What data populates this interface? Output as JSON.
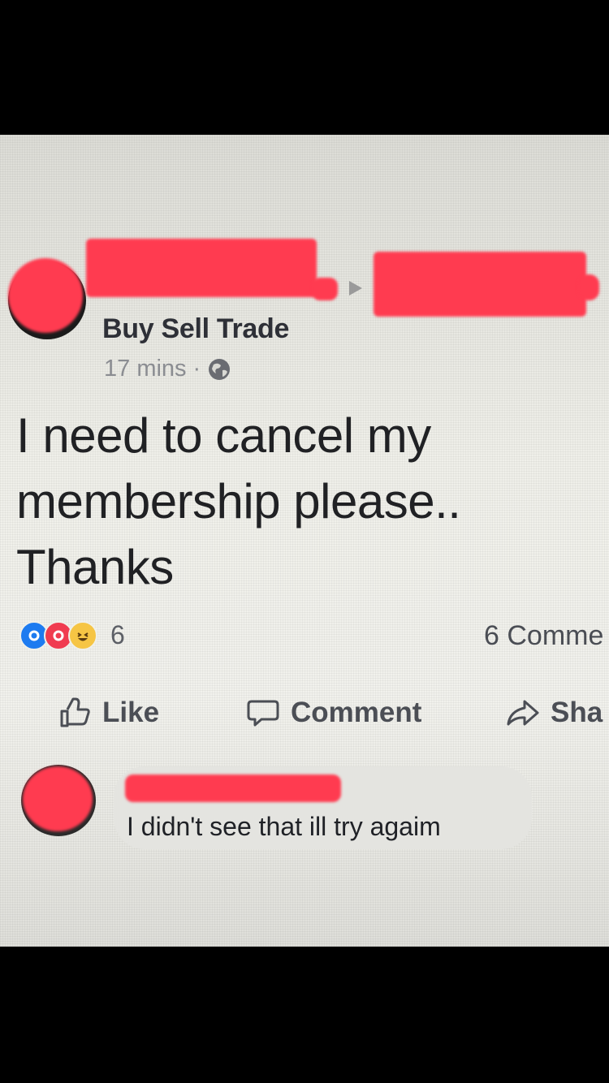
{
  "post": {
    "group_name": "Buy Sell Trade",
    "time": "17 mins",
    "separator": "·",
    "text_lines": [
      "I need to cancel my",
      "membership please..",
      "Thanks"
    ],
    "reaction_count": "6",
    "comment_count_label": "6 Comme"
  },
  "actions": {
    "like": "Like",
    "comment": "Comment",
    "share": "Sha"
  },
  "comment": {
    "text": "I didn't see that ill try agaim"
  },
  "icons": {
    "privacy": "globe-icon",
    "like": "thumbs-up-icon",
    "comment": "speech-bubble-icon",
    "share": "share-arrow-icon"
  },
  "colors": {
    "redaction": "#ff3b50",
    "like_reaction": "#1d7bf0",
    "love_reaction": "#f03c50",
    "haha_reaction": "#f6c544"
  }
}
